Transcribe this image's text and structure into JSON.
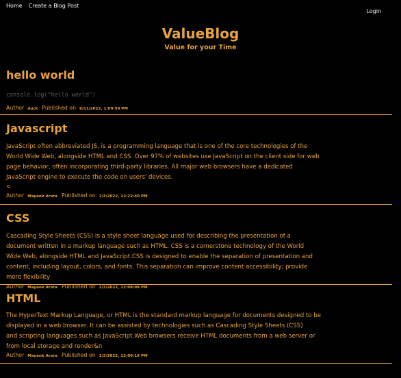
{
  "nav": {
    "home": "Home",
    "create_post": "Create a Blog Post",
    "login": "Login"
  },
  "brand": {
    "title": "ValueBlog",
    "subtitle": "Value for your Time"
  },
  "meta_labels": {
    "author": "Author",
    "published": "Published on"
  },
  "posts": [
    {
      "title": "hello world",
      "body": "console.log(\"hello world\")",
      "author": "duck",
      "date": "6/11/2022, 1:09:59 PM"
    },
    {
      "title": "Javascript",
      "body": "JavaScript often abbreviated JS, is a programming language that is one of the core technologies of the World Wide Web, alongside HTML and CSS. Over 97% of websites use JavaScript on the client side for web page behavior, often incorporating third-party libraries. All major web browsers have a dedicated JavaScript engine to execute the code on users' devices.",
      "extra": "<",
      "author": "Mayank Arora",
      "date": "2/3/2022, 12:22:40 PM"
    },
    {
      "title": "CSS",
      "body": "Cascading Style Sheets (CSS) is a style sheet language used for describing the presentation of a document written in a markup language such as HTML. CSS is a cornerstone technology of the World Wide Web, alongside HTML and JavaScript.CSS is designed to enable the separation of presentation and content, including layout, colors, and fonts. This separation can improve content accessibility; provide more flexibility",
      "author": "Mayank Arora",
      "date": "2/3/2022, 12:08:09 PM"
    },
    {
      "title": "HTML",
      "body1": "The HyperText Markup Language, or HTML is the standard markup language for documents designed to be displayed in a web browser. It can be assisted by technologies such as Cascading Style Sheets (CSS)",
      "body2": "and scripting languages such as JavaScript.Web browsers receive HTML documents from a web server or from local storage and render&n",
      "author": "Mayank Arora",
      "date": "2/3/2022, 12:00:19 PM"
    }
  ]
}
